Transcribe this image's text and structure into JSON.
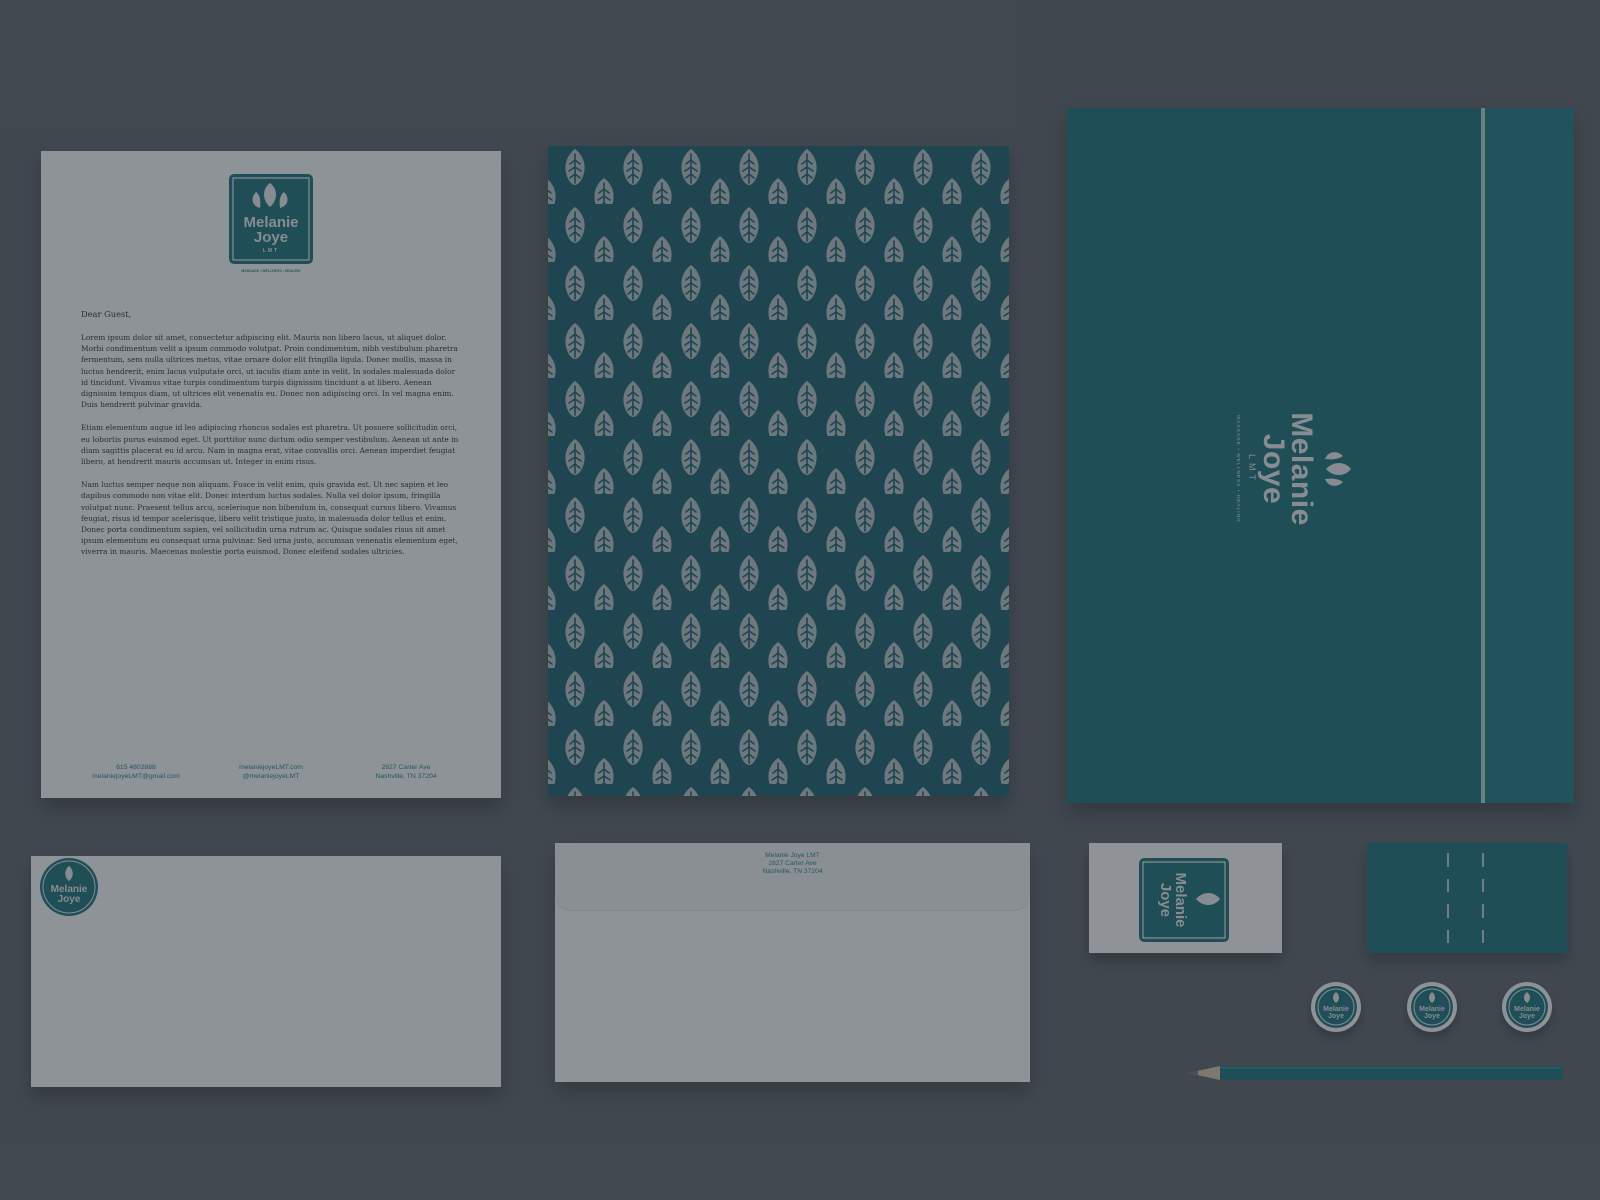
{
  "letterhead": {
    "logo_line1": "Melanie",
    "logo_line2": "Joye",
    "logo_line3": "LMT",
    "logo_tagline": "MASSAGE • WELLNESS • HEALING",
    "greeting": "Dear Guest,",
    "paragraphs": [
      "Lorem ipsum dolor sit amet, consectetur adipiscing elit. Mauris non libero lacus, ut aliquet dolor. Morbi condimentum velit a ipsum commodo volutpat. Proin condimentum, nibh vestibulum pharetra fermentum, sem nulla ultrices metus, vitae ornare dolor elit fringilla ligula. Donec mollis, massa in luctus hendrerit, enim lacus vulputate orci, ut iaculis diam ante in velit. In sodales malesuada dolor id tincidunt. Vivamus vitae turpis condimentum turpis dignissim tincidunt a at libero. Aenean dignissim tempus diam, ut ultrices elit venenatis eu. Donec non adipiscing orci. In vel magna enim. Duis hendrerit pulvinar gravida.",
      "Etiam elementum augue id leo adipiscing rhoncus sodales est pharetra. Ut posuere sollicitudin orci, eu lobortis purus euismod eget. Ut porttitor nunc dictum odio semper vestibulum. Aenean ut ante in diam sagittis placerat eu id arcu. Nam in magna erat, vitae convallis orci. Aenean imperdiet feugiat libero, at hendrerit mauris accumsan ut. Integer in enim risus.",
      "Nam luctus semper neque non aliquam. Fusce in velit enim, quis gravida est. Ut nec sapien et leo dapibus commodo non vitae elit. Donec interdum luctus sodales. Nulla vel dolor ipsum, fringilla volutpat nunc. Praesent tellus arcu, scelerisque non bibendum in, consequat cursus libero. Vivamus feugiat, risus id tempor scelerisque, libero velit tristique justo, in malesuada dolor tellus et enim. Donec porta condimentum sapien, vel sollicitudin urna rutrum ac. Quisque sodales risus sit amet ipsum elementum eu consequat urna pulvinar. Sed urna justo, accumsan venenatis elementum eget, viverra in mauris. Maecenas molestie porta euismod. Donec eleifend sodales ultricies."
    ],
    "footer": {
      "left": [
        "615 4802888",
        "melaniejoyeLMT@gmail.com"
      ],
      "center": [
        "melaniejoyeLMT.com",
        "@melaniejoyeLMT"
      ],
      "right": [
        "2827 Carter Ave",
        "Nashville, TN 37204"
      ]
    }
  },
  "envelope": {
    "return_address": [
      "Melanie Joye LMT",
      "2827 Carter Ave",
      "Nashville, TN 37204"
    ]
  },
  "colors": {
    "teal": "#1c6b72",
    "teal_dark": "#1c5965",
    "paper": "#e6e7e7",
    "background": "#5a5e63"
  }
}
